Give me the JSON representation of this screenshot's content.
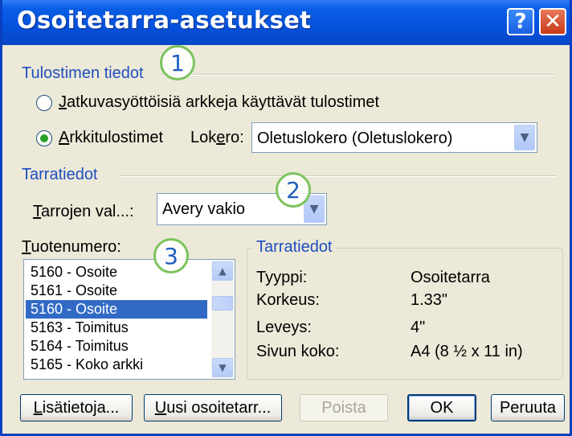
{
  "dialog": {
    "title": "Osoitetarra-asetukset",
    "help_glyph": "?",
    "close_glyph": "✕"
  },
  "printer_info": {
    "group_label": "Tulostimen tiedot",
    "continuous_feed_label": "Jatkuvasyöttöisiä arkkeja käyttävät tulostimet",
    "page_printers_label": "Arkkitulostimet",
    "selected": "page_printers",
    "tray_label": "Lokero:",
    "tray_value": "Oletuslokero (Oletuslokero)"
  },
  "label_info": {
    "group_label": "Tarratiedot",
    "vendor_label": "Tarrojen val...:",
    "vendor_value": "Avery vakio"
  },
  "product": {
    "label": "Tuotenumero:",
    "items": [
      "5160 - Osoite",
      "5161 - Osoite",
      "5160 - Osoite",
      "5163 - Toimitus",
      "5164 - Toimitus",
      "5165 - Koko arkki"
    ],
    "selected_index": 2
  },
  "details": {
    "group_label": "Tarratiedot",
    "type_label": "Tyyppi:",
    "type_value": "Osoitetarra",
    "height_label": "Korkeus:",
    "height_value": "1.33\"",
    "width_label": "Leveys:",
    "width_value": "4\"",
    "page_size_label": "Sivun koko:",
    "page_size_value": "A4 (8 ½ x 11 in)"
  },
  "buttons": {
    "details": "Lisätietoja...",
    "new_label": "Uusi osoitetarr...",
    "delete": "Poista",
    "ok": "OK",
    "cancel": "Peruuta"
  },
  "callouts": [
    "1",
    "2",
    "3"
  ],
  "colors": {
    "title_bar": "#0551dc",
    "group_label": "#1f4ec0",
    "callout_ring": "#7cc35c",
    "selection": "#316ac5"
  }
}
